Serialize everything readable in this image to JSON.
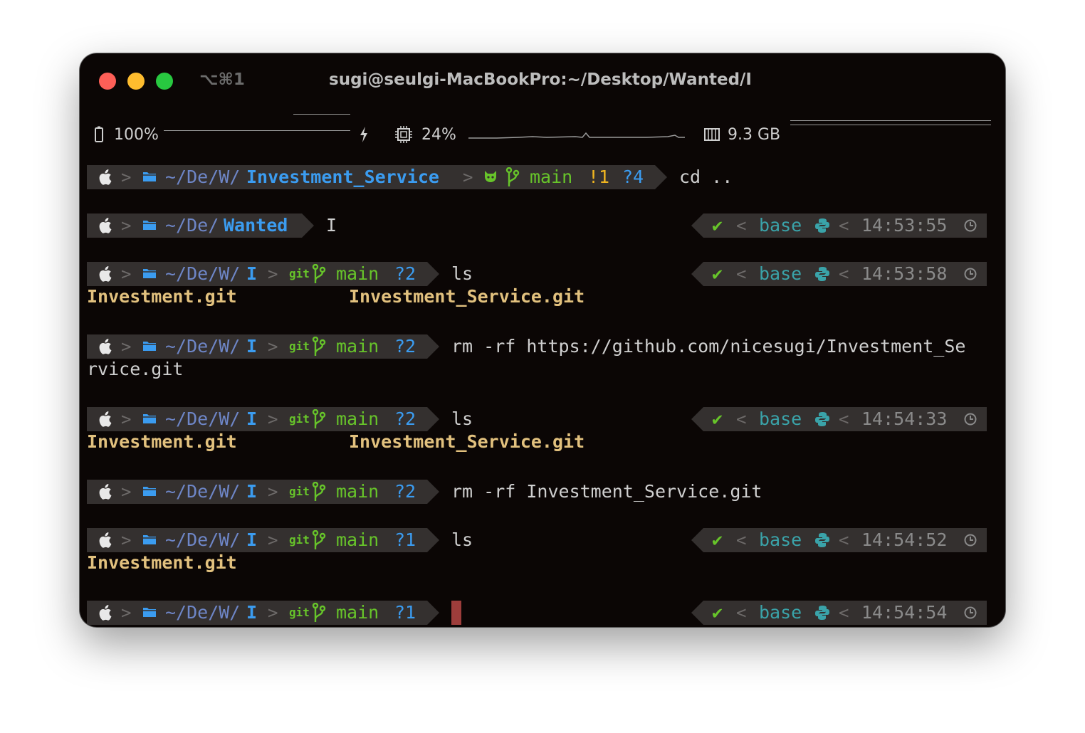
{
  "window": {
    "tab_shortcut": "⌥⌘1",
    "title": "sugi@seulgi-MacBookPro:~/Desktop/Wanted/I"
  },
  "status_bar": {
    "battery_label": "100%",
    "cpu_label": "24%",
    "memory_label": "9.3 GB"
  },
  "prompts": [
    {
      "cwd_prefix": "~/De/W/",
      "cwd_dir": "Investment_Service",
      "branch": "main",
      "modified": "!1",
      "untracked": "?4",
      "command": "cd .."
    },
    {
      "cwd_prefix": "~/De/",
      "cwd_dir": "Wanted",
      "command": "I",
      "env": "base",
      "time": "14:53:55"
    },
    {
      "cwd_prefix": "~/De/W/",
      "cwd_dir": "I",
      "branch": "main",
      "untracked": "?2",
      "command": "ls",
      "env": "base",
      "time": "14:53:58"
    },
    {
      "cwd_prefix": "~/De/W/",
      "cwd_dir": "I",
      "branch": "main",
      "untracked": "?2",
      "command": "rm -rf https://github.com/nicesugi/Investment_Se",
      "command_wrap": "rvice.git"
    },
    {
      "cwd_prefix": "~/De/W/",
      "cwd_dir": "I",
      "branch": "main",
      "untracked": "?2",
      "command": "ls",
      "env": "base",
      "time": "14:54:33"
    },
    {
      "cwd_prefix": "~/De/W/",
      "cwd_dir": "I",
      "branch": "main",
      "untracked": "?2",
      "command": "rm -rf Investment_Service.git"
    },
    {
      "cwd_prefix": "~/De/W/",
      "cwd_dir": "I",
      "branch": "main",
      "untracked": "?1",
      "command": "ls",
      "env": "base",
      "time": "14:54:52"
    },
    {
      "cwd_prefix": "~/De/W/",
      "cwd_dir": "I",
      "branch": "main",
      "untracked": "?1",
      "command": "",
      "env": "base",
      "time": "14:54:54"
    }
  ],
  "outputs": {
    "ls_1": [
      "Investment.git",
      "Investment_Service.git"
    ],
    "ls_2": [
      "Investment.git",
      "Investment_Service.git"
    ],
    "ls_3": [
      "Investment.git"
    ]
  },
  "colors": {
    "segment_bg": "#34302f",
    "path": "#3b9cf0",
    "git": "#67c42a",
    "env": "#3aa3a9",
    "output": "#e2c17e",
    "cursor": "#9d3d3b"
  },
  "icons": {
    "os": "apple-icon",
    "folder": "folder-icon",
    "github": "github-icon",
    "branch": "git-branch-icon",
    "git": "git-icon",
    "check": "check-icon",
    "python": "python-icon",
    "clock": "clock-icon"
  }
}
